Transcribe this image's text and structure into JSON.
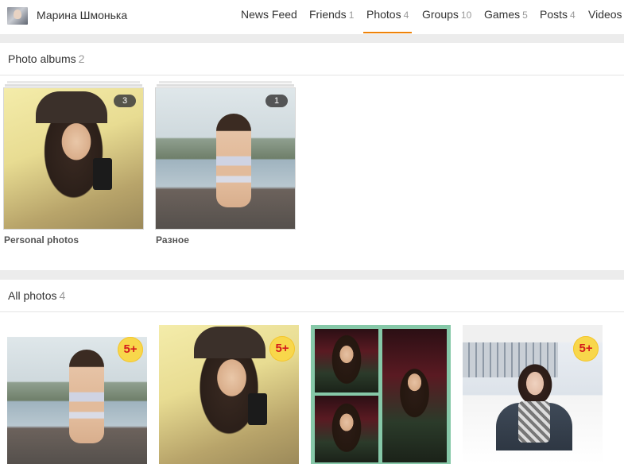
{
  "header": {
    "user_name": "Марина Шмонька",
    "nav": [
      {
        "label": "News Feed",
        "count": ""
      },
      {
        "label": "Friends",
        "count": "1"
      },
      {
        "label": "Photos",
        "count": "4"
      },
      {
        "label": "Groups",
        "count": "10"
      },
      {
        "label": "Games",
        "count": "5"
      },
      {
        "label": "Posts",
        "count": "4"
      },
      {
        "label": "Videos",
        "count": ""
      }
    ],
    "active_tab": "Photos",
    "accent_color": "#ee8208"
  },
  "albums_section": {
    "title": "Photo albums",
    "count": "2",
    "albums": [
      {
        "name": "Personal photos",
        "photo_count": "3"
      },
      {
        "name": "Разное",
        "photo_count": "1"
      }
    ]
  },
  "photos_section": {
    "title": "All photos",
    "count": "4",
    "photos": [
      {
        "age_badge": "5+"
      },
      {
        "age_badge": "5+"
      },
      {
        "age_badge": ""
      },
      {
        "age_badge": "5+"
      }
    ]
  }
}
